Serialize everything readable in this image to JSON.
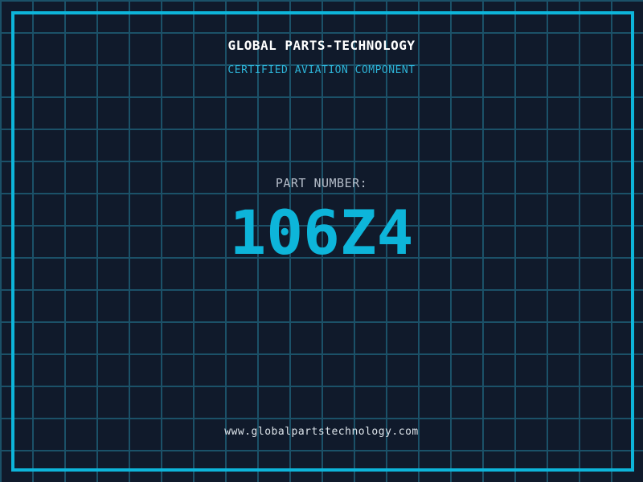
{
  "header": {
    "title": "GLOBAL PARTS-TECHNOLOGY",
    "subtitle": "CERTIFIED AVIATION COMPONENT"
  },
  "part": {
    "label": "PART NUMBER:",
    "number": "106Z4"
  },
  "footer": {
    "url": "www.globalpartstechnology.com"
  },
  "colors": {
    "background": "#101a2b",
    "grid_line": "#1b5168",
    "frame_border": "#0db5da",
    "title_text": "#ffffff",
    "subtitle_text": "#2db4d8",
    "part_label_text": "#b4bcc8",
    "part_number_text": "#0db5da",
    "footer_text": "#dde4ea"
  }
}
